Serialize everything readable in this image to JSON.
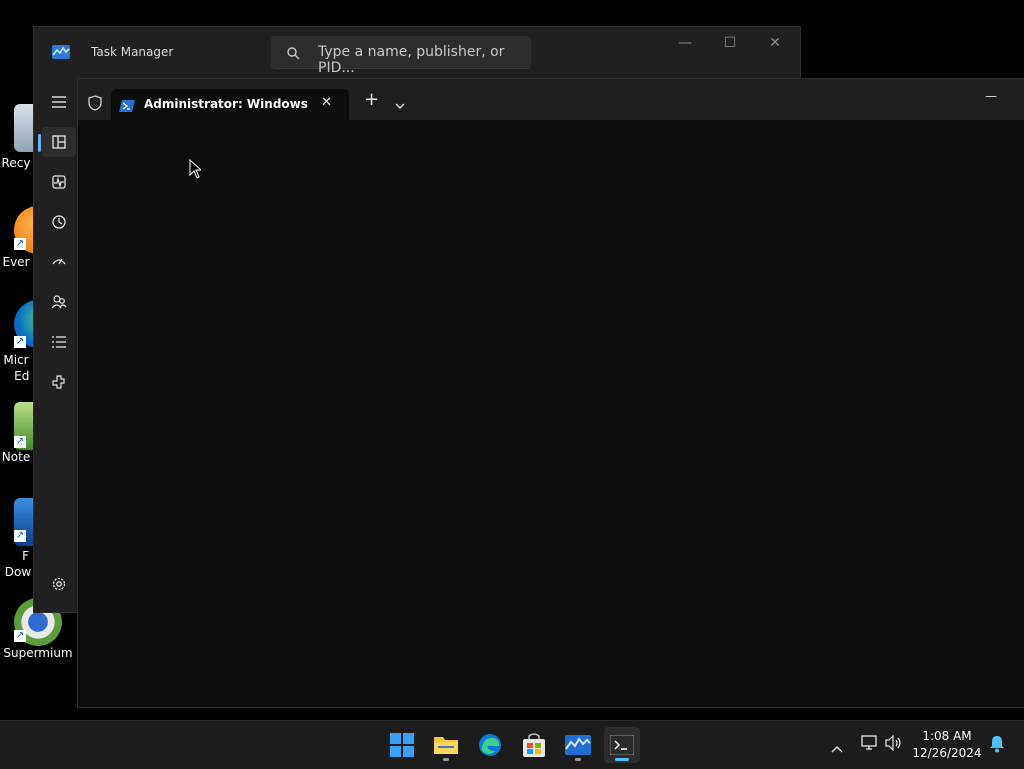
{
  "desktop": {
    "icons": [
      {
        "label": "Recy",
        "icon": "recycle-bin-icon"
      },
      {
        "label": "Ever",
        "icon": "everything-icon"
      },
      {
        "label": "Micr\nEd",
        "icon": "edge-icon"
      },
      {
        "label": "Note",
        "icon": "notepad-plus-icon"
      },
      {
        "label": "F\nDow",
        "icon": "download-app-icon"
      },
      {
        "label": "Supermium",
        "icon": "supermium-icon"
      }
    ]
  },
  "task_manager": {
    "title": "Task Manager",
    "search_placeholder": "Type a name, publisher, or PID...",
    "nav": [
      "processes-icon",
      "performance-icon",
      "app-history-icon",
      "startup-apps-icon",
      "users-icon",
      "details-icon",
      "services-icon",
      "settings-icon"
    ]
  },
  "terminal": {
    "tab_title": "Administrator: Windows PowerShell",
    "new_tab": "+",
    "close_tab": "✕",
    "minimize": "—"
  },
  "taskbar": {
    "apps": [
      "start-icon",
      "file-explorer-icon",
      "edge-icon",
      "store-icon",
      "task-manager-icon",
      "terminal-icon"
    ],
    "active_app": "terminal-icon",
    "time": "1:08 AM",
    "date": "12/26/2024"
  },
  "colors": {
    "accent": "#4cc2ff",
    "window_bg": "#202020",
    "terminal_bg": "#0c0c0c"
  }
}
